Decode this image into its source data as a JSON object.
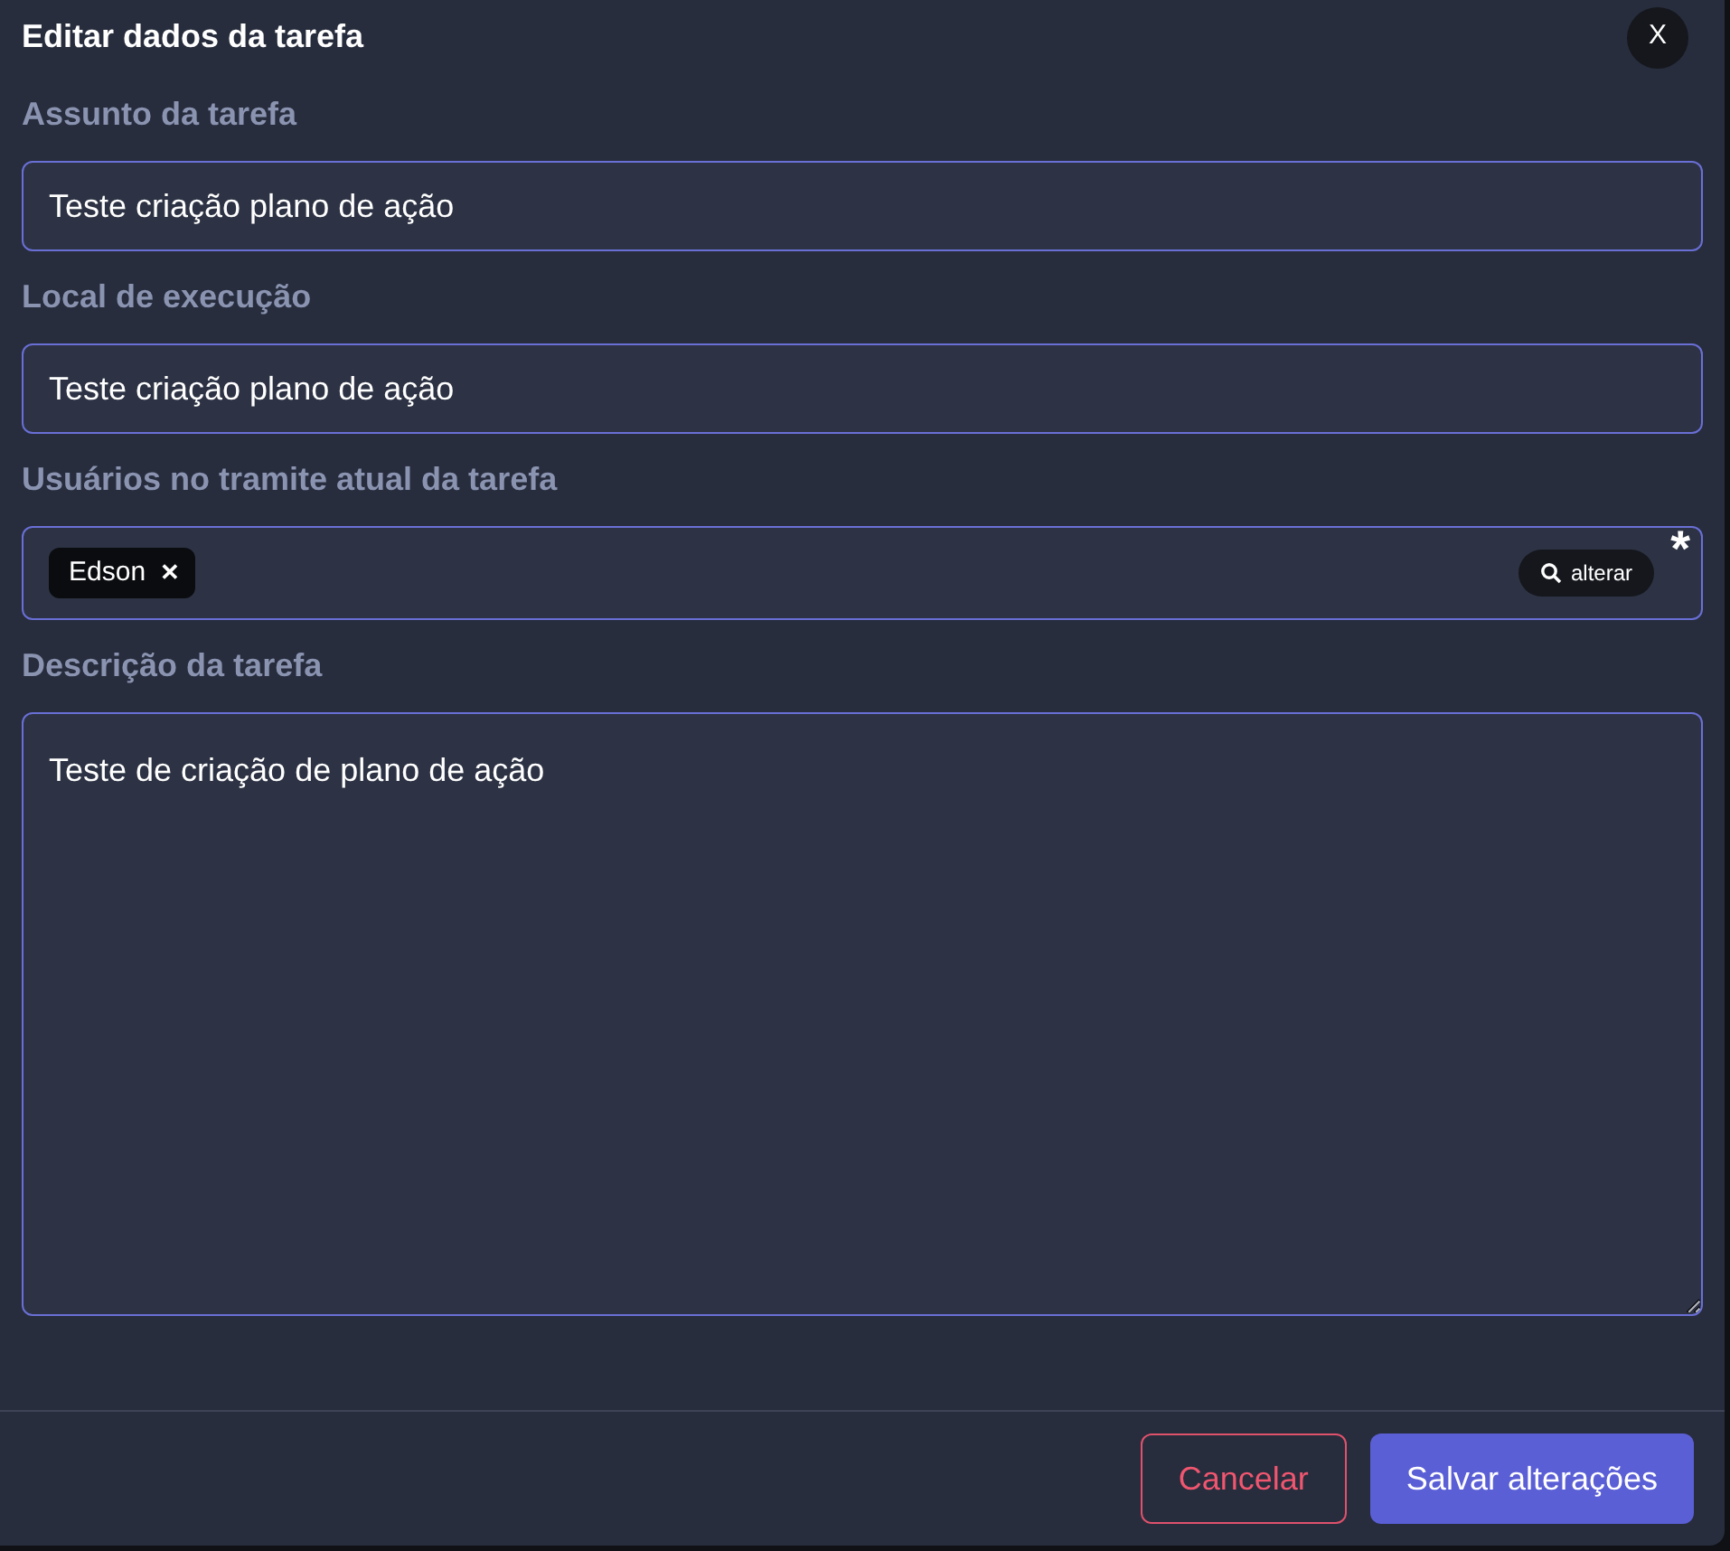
{
  "dialog": {
    "title": "Editar dados da tarefa",
    "close_label": "X"
  },
  "fields": [
    {
      "kind": "text",
      "label": "Assunto da tarefa",
      "value": "Teste criação plano de ação"
    },
    {
      "kind": "text",
      "label": "Local de execução",
      "value": "Teste criação plano de ação"
    },
    {
      "kind": "users",
      "label": "Usuários no tramite atual da tarefa",
      "tags": [
        {
          "label": "Edson",
          "remove": "✕"
        }
      ],
      "action": "alterar",
      "required_mark": "*"
    },
    {
      "kind": "textarea",
      "label": "Descrição da tarefa",
      "value": "Teste de criação de plano de ação"
    }
  ],
  "buttons": [
    {
      "kind": "secondary",
      "label": "Cancelar"
    },
    {
      "kind": "primary",
      "label": "Salvar alterações"
    }
  ]
}
